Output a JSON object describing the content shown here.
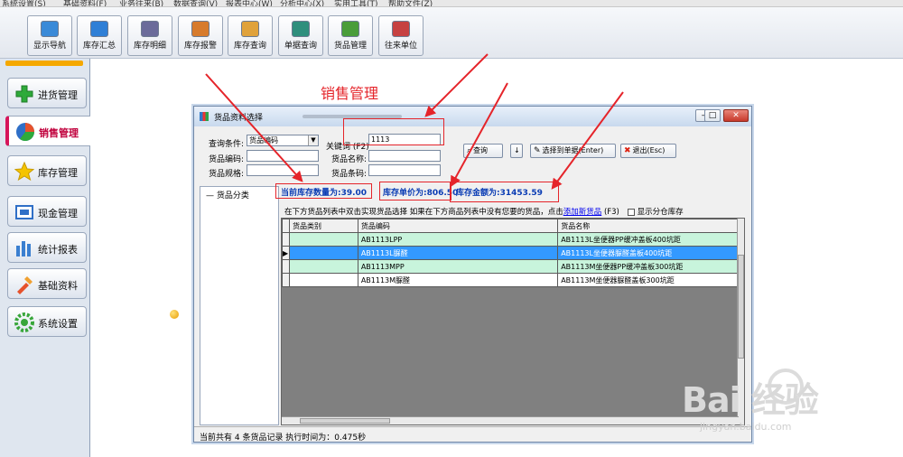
{
  "menu": [
    "系统设置(S)",
    "基础资料(F)",
    "业务往来(B)",
    "数据查询(V)",
    "报表中心(W)",
    "分析中心(X)",
    "实用工具(T)",
    "帮助文件(Z)"
  ],
  "toolbar": [
    {
      "label": "显示导航",
      "icon": "navigation-icon",
      "color": "#3a8ad8"
    },
    {
      "label": "库存汇总",
      "icon": "inventory-summary-icon",
      "color": "#2f7fd6"
    },
    {
      "label": "库存明细",
      "icon": "inventory-detail-icon",
      "color": "#6b6b9a"
    },
    {
      "label": "库存报警",
      "icon": "inventory-alarm-icon",
      "color": "#d77b2d"
    },
    {
      "label": "库存查询",
      "icon": "inventory-query-icon",
      "color": "#e0a23b"
    },
    {
      "label": "单据查询",
      "icon": "document-query-icon",
      "color": "#2f8f7d"
    },
    {
      "label": "货品管理",
      "icon": "goods-management-icon",
      "color": "#4a9d3a"
    },
    {
      "label": "往来单位",
      "icon": "partner-icon",
      "color": "#c64141"
    }
  ],
  "nav": [
    {
      "label": "进货管理",
      "icon": "plus-icon",
      "color": "#2eaa3a",
      "active": false
    },
    {
      "label": "销售管理",
      "icon": "pie-chart-icon",
      "color": "#d6165a",
      "active": true
    },
    {
      "label": "库存管理",
      "icon": "star-icon",
      "color": "#f5c400",
      "active": false
    },
    {
      "label": "现金管理",
      "icon": "cash-icon",
      "color": "#2f6fc7",
      "active": false
    },
    {
      "label": "统计报表",
      "icon": "bar-chart-icon",
      "color": "#3a7fd0",
      "active": false
    },
    {
      "label": "基础资料",
      "icon": "tools-icon",
      "color": "#e6522c",
      "active": false
    },
    {
      "label": "系统设置",
      "icon": "gear-icon",
      "color": "#38a63a",
      "active": false
    }
  ],
  "annotation_title": "销售管理",
  "dialog": {
    "title": "货品资料选择",
    "query_condition_label": "查询条件:",
    "query_condition_value": "货品编码",
    "keyword_label": "关键词 (F2)",
    "keyword_value": "1113",
    "code_label": "货品编码:",
    "name_label": "货品名称:",
    "spec_label": "货品规格:",
    "barcode_label": "货品条码:",
    "query_button": "查询",
    "query_dropdown": "↓",
    "select_button": "选择到单据(Enter)",
    "exit_button": "退出(Esc)",
    "tree_root": "货品分类",
    "stock_qty": "当前库存数量为:39.00",
    "unit_price": "库存单价为:806.50",
    "amount": "库存金额为:31453.59",
    "tip_text": "在下方货品列表中双击实现货品选择  如果在下方商品列表中没有您要的货品，点击",
    "tip_link": "添加新货品",
    "tip_suffix": "(F3)",
    "checkbox_label": "显示分仓库存",
    "columns": [
      "货品类别",
      "货品编码",
      "货品名称"
    ],
    "rows": [
      {
        "category": "",
        "code": "AB1113LPP",
        "name": "AB1113L坐便器PP缓冲盖板400坑距"
      },
      {
        "category": "",
        "code": "AB1113L脲醛",
        "name": "AB1113L坐便器脲醛盖板400坑距"
      },
      {
        "category": "",
        "code": "AB1113MPP",
        "name": "AB1113M坐便器PP缓冲盖板300坑距"
      },
      {
        "category": "",
        "code": "AB1113M脲醛",
        "name": "AB1113M坐便器脲醛盖板300坑距"
      }
    ],
    "status_text": "当前共有 4 条货品记录  执行时间为：0.475秒"
  },
  "watermark": {
    "main": "Bai 经验",
    "sub": "jingyan.baidu.com"
  }
}
